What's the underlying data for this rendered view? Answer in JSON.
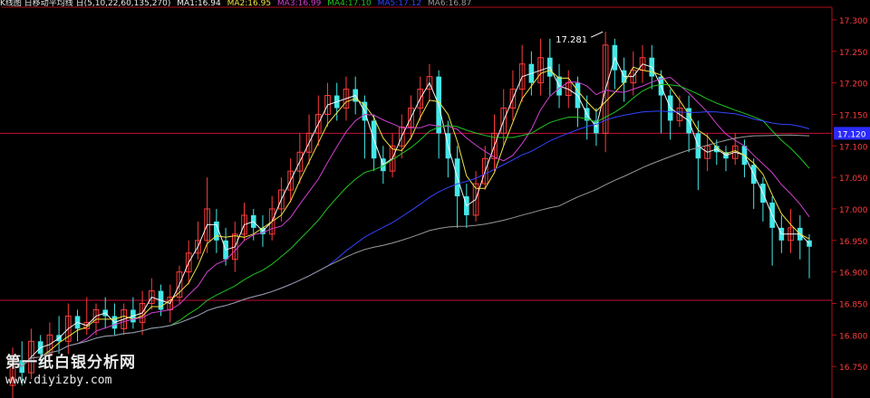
{
  "legend": {
    "title": "K线图 日移动平均线 日(5,10,22,60,135,270)",
    "items": [
      {
        "label": "MA1:16.94",
        "color": "#f5f5f5"
      },
      {
        "label": "MA2:16.95",
        "color": "#f0e442"
      },
      {
        "label": "MA3:16.99",
        "color": "#d040d0"
      },
      {
        "label": "MA4:17.10",
        "color": "#22c322"
      },
      {
        "label": "MA5:17.12",
        "color": "#3344ff"
      },
      {
        "label": "MA6:16.87",
        "color": "#9a9a9a"
      }
    ]
  },
  "watermark": {
    "line1": "第一纸白银分析网",
    "line2": "www.diyizby.com"
  },
  "chart_data": {
    "type": "line",
    "subtype": "candlestick",
    "ylim": [
      16.7,
      17.32
    ],
    "y_ticks": [
      "17.300",
      "17.250",
      "17.200",
      "17.150",
      "17.100",
      "17.050",
      "17.000",
      "16.950",
      "16.900",
      "16.850",
      "16.800",
      "16.750"
    ],
    "y_tick_values": [
      17.3,
      17.25,
      17.2,
      17.15,
      17.1,
      17.05,
      17.0,
      16.95,
      16.9,
      16.85,
      16.8,
      16.75
    ],
    "price_highlight": {
      "label": "17.120",
      "value": 17.12
    },
    "horizontal_lines": [
      17.12,
      16.855
    ],
    "annotation": {
      "label": "17.281",
      "value": 17.281
    },
    "grid": false,
    "colors": {
      "up": "#ff3b3b",
      "down": "#44e8e8",
      "axis": "#b01018",
      "tick_text": "#ff3b3b",
      "hline": "#c0103a"
    },
    "candles": [
      [
        16.72,
        16.76,
        16.7,
        16.78
      ],
      [
        16.76,
        16.74,
        16.72,
        16.79
      ],
      [
        16.74,
        16.79,
        16.73,
        16.81
      ],
      [
        16.79,
        16.77,
        16.75,
        16.8
      ],
      [
        16.77,
        16.8,
        16.76,
        16.82
      ],
      [
        16.8,
        16.79,
        16.77,
        16.83
      ],
      [
        16.79,
        16.83,
        16.77,
        16.85
      ],
      [
        16.83,
        16.81,
        16.79,
        16.84
      ],
      [
        16.81,
        16.82,
        16.8,
        16.86
      ],
      [
        16.82,
        16.84,
        16.8,
        16.85
      ],
      [
        16.84,
        16.83,
        16.81,
        16.86
      ],
      [
        16.83,
        16.81,
        16.8,
        16.85
      ],
      [
        16.81,
        16.84,
        16.8,
        16.85
      ],
      [
        16.84,
        16.82,
        16.81,
        16.86
      ],
      [
        16.82,
        16.85,
        16.8,
        16.87
      ],
      [
        16.85,
        16.87,
        16.84,
        16.89
      ],
      [
        16.87,
        16.84,
        16.83,
        16.88
      ],
      [
        16.84,
        16.86,
        16.82,
        16.88
      ],
      [
        16.86,
        16.9,
        16.85,
        16.91
      ],
      [
        16.9,
        16.93,
        16.88,
        16.95
      ],
      [
        16.93,
        16.95,
        16.92,
        16.98
      ],
      [
        16.95,
        17.0,
        16.93,
        17.05
      ],
      [
        16.98,
        16.95,
        16.93,
        17.0
      ],
      [
        16.95,
        16.92,
        16.91,
        16.97
      ],
      [
        16.92,
        16.96,
        16.9,
        16.98
      ],
      [
        16.96,
        16.99,
        16.95,
        17.01
      ],
      [
        16.99,
        16.97,
        16.95,
        17.0
      ],
      [
        16.97,
        16.96,
        16.94,
        16.99
      ],
      [
        16.96,
        17.0,
        16.95,
        17.02
      ],
      [
        17.0,
        17.03,
        16.98,
        17.05
      ],
      [
        17.03,
        17.06,
        17.01,
        17.08
      ],
      [
        17.06,
        17.09,
        17.04,
        17.12
      ],
      [
        17.09,
        17.12,
        17.07,
        17.15
      ],
      [
        17.12,
        17.15,
        17.1,
        17.18
      ],
      [
        17.15,
        17.18,
        17.13,
        17.2
      ],
      [
        17.18,
        17.16,
        17.14,
        17.2
      ],
      [
        17.16,
        17.19,
        17.14,
        17.21
      ],
      [
        17.19,
        17.17,
        17.15,
        17.21
      ],
      [
        17.17,
        17.14,
        17.08,
        17.18
      ],
      [
        17.14,
        17.08,
        17.06,
        17.15
      ],
      [
        17.08,
        17.06,
        17.04,
        17.1
      ],
      [
        17.06,
        17.1,
        17.05,
        17.12
      ],
      [
        17.1,
        17.13,
        17.08,
        17.15
      ],
      [
        17.13,
        17.16,
        17.11,
        17.18
      ],
      [
        17.16,
        17.19,
        17.14,
        17.21
      ],
      [
        17.19,
        17.21,
        17.17,
        17.23
      ],
      [
        17.21,
        17.12,
        17.08,
        17.22
      ],
      [
        17.12,
        17.08,
        17.05,
        17.14
      ],
      [
        17.08,
        17.02,
        16.97,
        17.1
      ],
      [
        17.02,
        16.99,
        16.97,
        17.04
      ],
      [
        16.99,
        17.04,
        16.98,
        17.06
      ],
      [
        17.04,
        17.08,
        17.03,
        17.1
      ],
      [
        17.08,
        17.12,
        17.06,
        17.15
      ],
      [
        17.12,
        17.16,
        17.1,
        17.19
      ],
      [
        17.16,
        17.19,
        17.14,
        17.22
      ],
      [
        17.19,
        17.23,
        17.17,
        17.26
      ],
      [
        17.23,
        17.2,
        17.18,
        17.25
      ],
      [
        17.2,
        17.24,
        17.18,
        17.27
      ],
      [
        17.24,
        17.21,
        17.18,
        17.27
      ],
      [
        17.21,
        17.18,
        17.16,
        17.23
      ],
      [
        17.18,
        17.2,
        17.16,
        17.22
      ],
      [
        17.2,
        17.16,
        17.13,
        17.21
      ],
      [
        17.16,
        17.14,
        17.11,
        17.18
      ],
      [
        17.14,
        17.12,
        17.1,
        17.16
      ],
      [
        17.12,
        17.26,
        17.09,
        17.281
      ],
      [
        17.26,
        17.22,
        17.19,
        17.27
      ],
      [
        17.22,
        17.2,
        17.17,
        17.24
      ],
      [
        17.2,
        17.22,
        17.18,
        17.25
      ],
      [
        17.22,
        17.24,
        17.2,
        17.26
      ],
      [
        17.24,
        17.21,
        17.19,
        17.26
      ],
      [
        17.21,
        17.18,
        17.12,
        17.22
      ],
      [
        17.18,
        17.14,
        17.11,
        17.19
      ],
      [
        17.14,
        17.16,
        17.13,
        17.18
      ],
      [
        17.16,
        17.12,
        17.09,
        17.18
      ],
      [
        17.12,
        17.08,
        17.03,
        17.14
      ],
      [
        17.08,
        17.1,
        17.06,
        17.12
      ],
      [
        17.1,
        17.09,
        17.07,
        17.11
      ],
      [
        17.09,
        17.08,
        17.06,
        17.1
      ],
      [
        17.08,
        17.1,
        17.07,
        17.12
      ],
      [
        17.1,
        17.07,
        17.05,
        17.11
      ],
      [
        17.07,
        17.04,
        17.0,
        17.08
      ],
      [
        17.04,
        17.01,
        16.98,
        17.05
      ],
      [
        17.01,
        16.97,
        16.91,
        17.02
      ],
      [
        16.97,
        16.95,
        16.93,
        16.99
      ],
      [
        16.95,
        16.97,
        16.93,
        17.0
      ],
      [
        16.97,
        16.95,
        16.92,
        16.99
      ],
      [
        16.95,
        16.94,
        16.89,
        16.96
      ]
    ]
  }
}
